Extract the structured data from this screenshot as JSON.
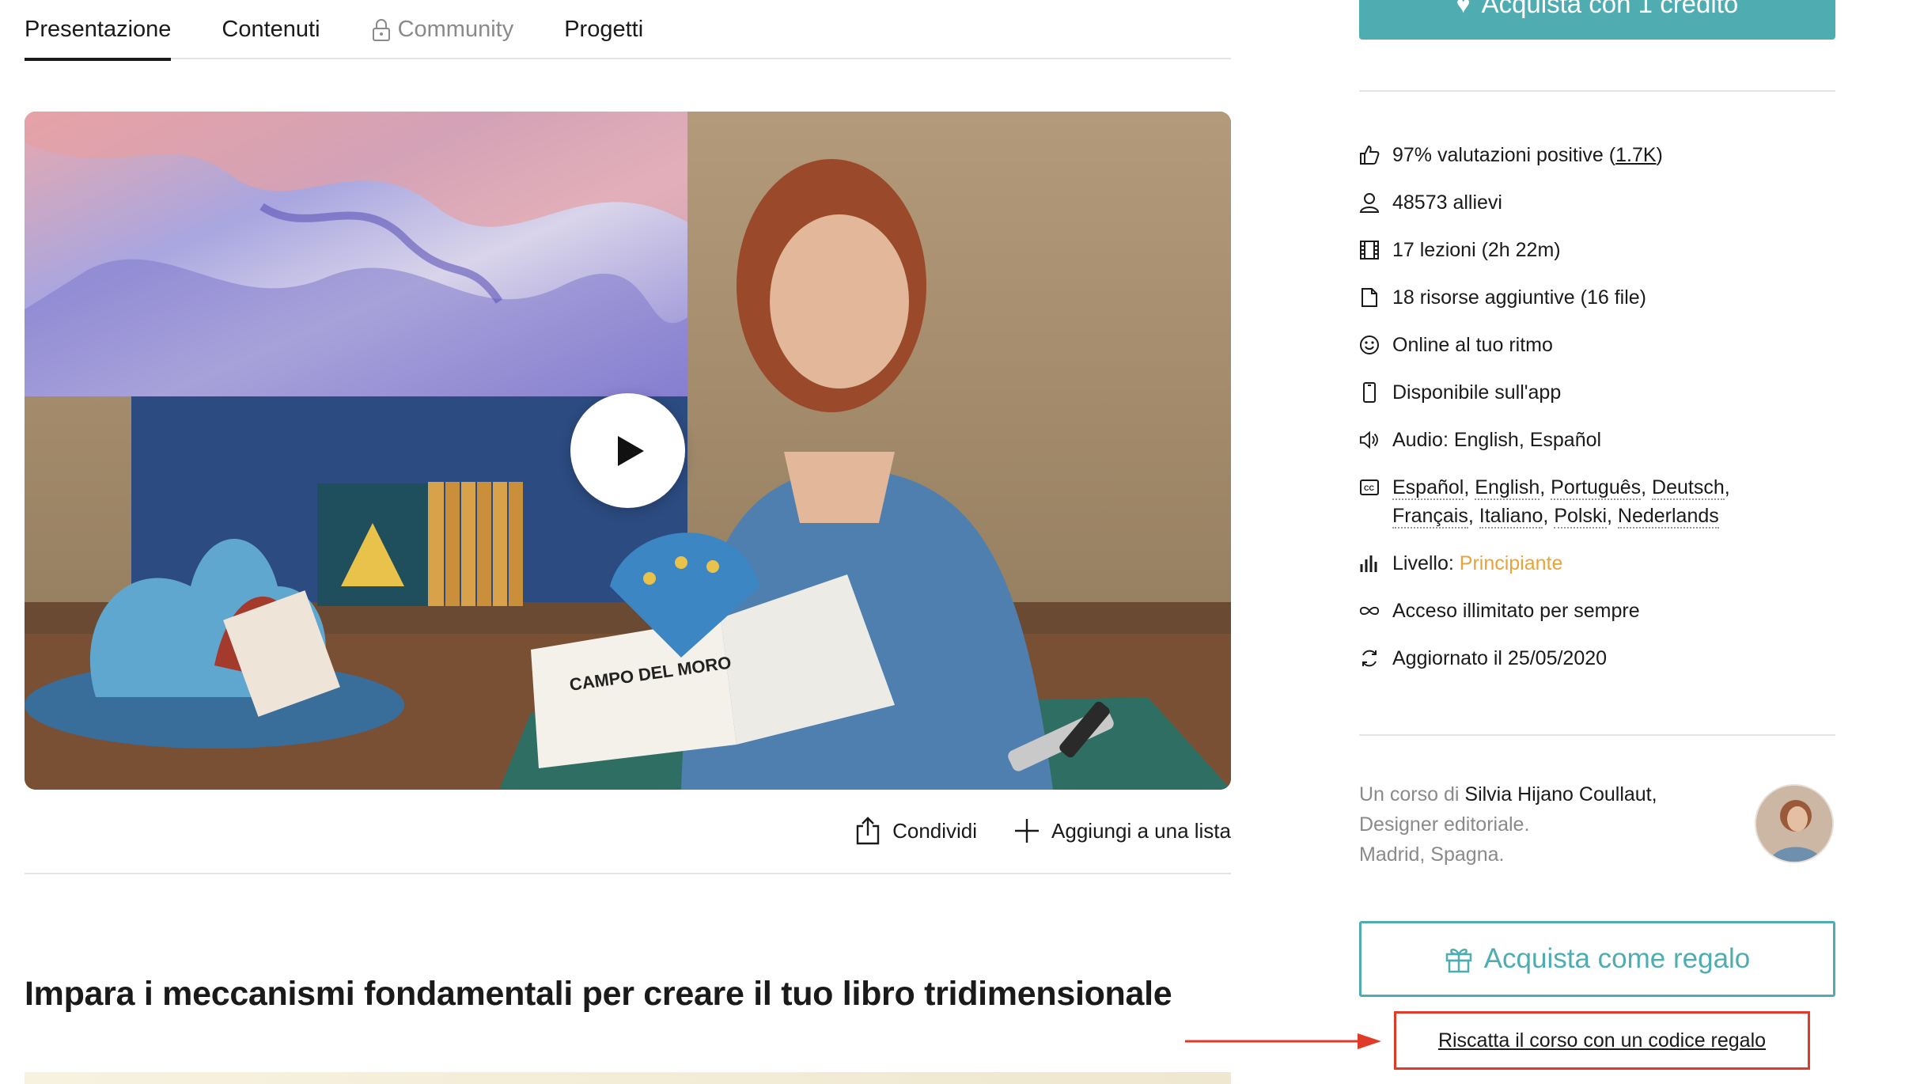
{
  "tabs": [
    {
      "label": "Presentazione",
      "active": true,
      "locked": false
    },
    {
      "label": "Contenuti",
      "active": false,
      "locked": false
    },
    {
      "label": "Community",
      "active": false,
      "locked": true
    },
    {
      "label": "Progetti",
      "active": false,
      "locked": false
    }
  ],
  "video": {
    "book_title": "CAMPO DEL MORO"
  },
  "actions": {
    "share_label": "Condividi",
    "add_list_label": "Aggiungi a una lista"
  },
  "headline": "Impara i meccanismi fondamentali per creare il tuo libro tridimensionale",
  "sidebar": {
    "buy_label": "Acquista con 1 credito",
    "features": {
      "rating_text": "97% valutazioni positive (",
      "rating_count": "1.7K",
      "rating_close": ")",
      "students": "48573 allievi",
      "lessons": "17 lezioni (2h 22m)",
      "resources": "18 risorse aggiuntive (16 file)",
      "online": "Online al tuo ritmo",
      "app": "Disponibile sull'app",
      "audio": "Audio: English, Español",
      "subtitles": [
        "Español",
        "English",
        "Português",
        "Deutsch",
        "Français",
        "Italiano",
        "Polski",
        "Nederlands"
      ],
      "level_label": "Livello: ",
      "level_value": "Principiante",
      "access": "Acceso illimitato per sempre",
      "updated": "Aggiornato il 25/05/2020"
    },
    "author": {
      "prefix": "Un corso di ",
      "name": "Silvia Hijano Coullaut,",
      "role": "Designer editoriale.",
      "location": "Madrid, Spagna."
    },
    "gift_label": "Acquista come regalo",
    "redeem_label": "Riscatta il corso con un codice regalo"
  },
  "colors": {
    "accent": "#4fadb2",
    "level": "#e8a33a",
    "highlight": "#e03a28"
  }
}
